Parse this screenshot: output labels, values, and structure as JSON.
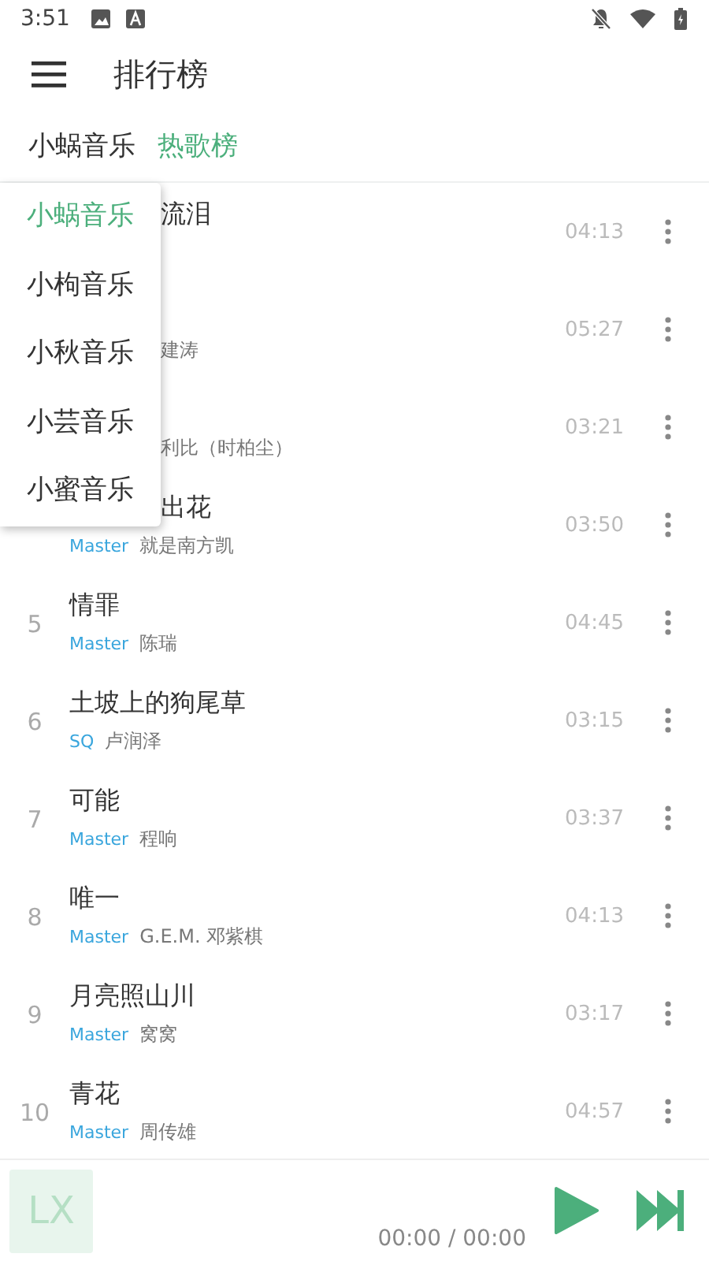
{
  "status_bar": {
    "time": "3:51"
  },
  "header": {
    "title": "排行榜"
  },
  "tabs": [
    {
      "label": "小蜗音乐",
      "selected": false
    },
    {
      "label": "热歌榜",
      "selected": true
    }
  ],
  "songs": [
    {
      "kind": "covered",
      "title": "流泪",
      "duration": "04:13"
    },
    {
      "kind": "covered",
      "artist": "建涛",
      "duration": "05:27"
    },
    {
      "kind": "covered",
      "artist": "利比（时柏尘）",
      "duration": "03:21"
    },
    {
      "kind": "title-covered",
      "title": "出花",
      "quality": "Master",
      "artist": "就是南方凯",
      "duration": "03:50"
    },
    {
      "kind": "full",
      "rank": "5",
      "title": "情罪",
      "quality": "Master",
      "artist": "陈瑞",
      "duration": "04:45"
    },
    {
      "kind": "full",
      "rank": "6",
      "title": "土坡上的狗尾草",
      "quality": "SQ",
      "artist": "卢润泽",
      "duration": "03:15"
    },
    {
      "kind": "full",
      "rank": "7",
      "title": "可能",
      "quality": "Master",
      "artist": "程响",
      "duration": "03:37"
    },
    {
      "kind": "full",
      "rank": "8",
      "title": "唯一",
      "quality": "Master",
      "artist": "G.E.M. 邓紫棋",
      "duration": "04:13"
    },
    {
      "kind": "full",
      "rank": "9",
      "title": "月亮照山川",
      "quality": "Master",
      "artist": "窝窝",
      "duration": "03:17"
    },
    {
      "kind": "full",
      "rank": "10",
      "title": "青花",
      "quality": "Master",
      "artist": "周传雄",
      "duration": "04:57"
    }
  ],
  "source_menu": [
    {
      "label": "小蜗音乐",
      "selected": true
    },
    {
      "label": "小枸音乐",
      "selected": false
    },
    {
      "label": "小秋音乐",
      "selected": false
    },
    {
      "label": "小芸音乐",
      "selected": false
    },
    {
      "label": "小蜜音乐",
      "selected": false
    }
  ],
  "player": {
    "cover_text": "LX",
    "time": "00:00 / 00:00"
  }
}
